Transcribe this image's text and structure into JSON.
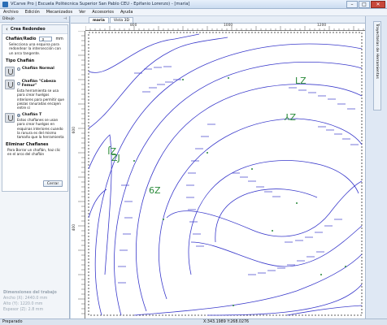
{
  "window": {
    "title": "VCarve Pro | Escuela Politécnica Superior San Pablo CEU - Epifanio Lorenzo) - [maria]"
  },
  "menu": [
    "Archivo",
    "Edición",
    "Mecanizados",
    "Ver",
    "Accesorios",
    "Ayuda"
  ],
  "left_panel": {
    "header": "Dibujo",
    "tool_title": "Crea Redondeo",
    "radius_label": "Chaflán/Radio",
    "radius_value": "3",
    "radius_unit": "mm",
    "intro": "Selecciona una esquina para redondear la intersección con un arco tangente.",
    "type_title": "Tipo Chaflán",
    "options": [
      {
        "label": "Chaflán Normal",
        "text": "",
        "selected": false
      },
      {
        "label": "Chaflán \"Cabeza Femur\"",
        "text": "Esta herramienta se usa para crear huelgos interiores para permitir que piezas ranuradas encajen entre sí",
        "selected": false
      },
      {
        "label": "Chaflán T",
        "text": "Estos chaflanes se usan para crear huelgos en esquinas interiores cuando la ranura es del mismo tamaño que la herramienta",
        "selected": true
      }
    ],
    "remove_title": "Eliminar Chaflanes",
    "remove_text": "Para Borrar un chaflán, haz clic en el arco del chaflán",
    "close_button": "Cerrar"
  },
  "job_dims": {
    "title": "Dimensiones del trabajo",
    "width": "Ancho  (X): 2440.0 mm",
    "height": "Alto     (Y): 1220.0 mm",
    "thickness": "Espesor (Z): 2.8 mm"
  },
  "tabs": [
    "maria",
    "Vista 3D"
  ],
  "rulers": {
    "top": [
      "800",
      "1000",
      "1200"
    ],
    "left": [
      "600",
      "400"
    ]
  },
  "canvas_labels": [
    "LZ",
    "ZY",
    "ZJ",
    "ZJ",
    "6Z"
  ],
  "right_panel": {
    "tab": "Trayectorias de Herramientas"
  },
  "status": {
    "left": "Preparado",
    "coords": "X:343.1989 Y:268.0276"
  },
  "colors": {
    "vector": "#3a3acb",
    "accent": "#1f4f89",
    "label": "#2a8a3a"
  }
}
